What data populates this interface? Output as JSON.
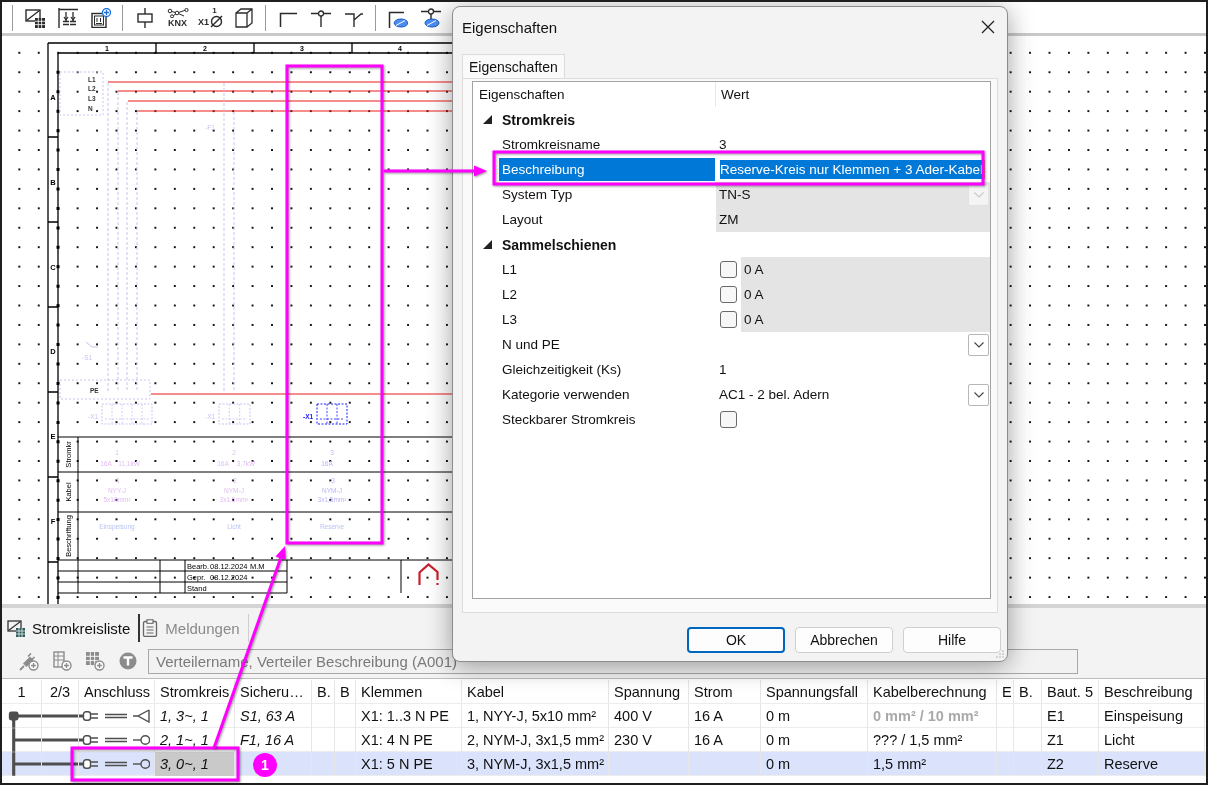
{
  "toolbar": {
    "knx_label": "KNX",
    "terminal_label": "X1",
    "terminal_number": "1"
  },
  "schematic": {
    "column_numbers": [
      "1",
      "2",
      "3",
      "4"
    ],
    "row_letters": [
      "A",
      "B",
      "C",
      "D",
      "E",
      "F"
    ],
    "busbars": [
      "L1",
      "L2",
      "L3",
      "N"
    ],
    "pe_label": "PE",
    "devices": [
      "-F1",
      "-S1"
    ],
    "table_labels": [
      "Stromkr",
      "Kabel",
      "Beschriftung"
    ],
    "circuits": [
      {
        "number": "1",
        "fuse": "16A",
        "power": "11,1kW",
        "cable_name": "-1",
        "cable_type": "NYY-J",
        "cable_size": "5x10mm²",
        "description": "Einspeisung",
        "terminal": "-X1",
        "selected": false
      },
      {
        "number": "2",
        "fuse": "16A",
        "power": "3,7kW",
        "cable_name": "-2",
        "cable_type": "NYM-J",
        "cable_size": "3x1,5mm²",
        "description": "Licht",
        "terminal": "-X1",
        "selected": false
      },
      {
        "number": "3",
        "fuse": "16A",
        "cable_name": "-3",
        "cable_type": "NYM-J",
        "cable_size": "3x1,5mm²",
        "description": "Reserve",
        "terminal": "-X1",
        "selected": true
      }
    ],
    "title_block": [
      {
        "label": "Bearb.",
        "date": "08.12.2024",
        "name": "M.M"
      },
      {
        "label": "Gepr.",
        "date": "08.12.2024"
      },
      {
        "label": "Stand"
      }
    ]
  },
  "panel": {
    "tabs": [
      {
        "label": "Stromkreisliste",
        "selected": true
      },
      {
        "label": "Meldungen",
        "selected": false
      }
    ],
    "distribution_field": {
      "value": "Verteilername, Verteiler Beschreibung (A001)",
      "disabled": true
    },
    "table": {
      "columns": [
        "1",
        "2/3",
        "Anschluss",
        "Stromkreis",
        "Sicheru…",
        "B.",
        "B",
        "Klemmen",
        "Kabel",
        "Spannung",
        "Strom",
        "Spannungsfall",
        "Kabelberechnung",
        "E",
        "B.",
        "Baut. 5",
        "Beschreibung"
      ],
      "rows": [
        {
          "kind": "feed",
          "selected": false,
          "circuit": "1, 3~, 1",
          "circuit_focused": false,
          "fuse": "S1, 63 A",
          "terminals": "X1: 1..3 N PE",
          "cable": "1, NYY-J, 5x10 mm²",
          "voltage": "400 V",
          "current": "16 A",
          "voltage_drop": "0 m",
          "cable_calc": "0 mm² / 10 mm²",
          "cable_calc_greyed": true,
          "component": "E1",
          "description": "Einspeisung"
        },
        {
          "kind": "outlet",
          "selected": false,
          "circuit": "2, 1~, 1",
          "circuit_focused": false,
          "fuse": "F1, 16 A",
          "terminals": "X1: 4 N PE",
          "cable": "2, NYM-J, 3x1,5 mm²",
          "voltage": "230 V",
          "current": "16 A",
          "voltage_drop": "0 m",
          "cable_calc": "??? / 1,5 mm²",
          "cable_calc_greyed": false,
          "component": "Z1",
          "description": "Licht"
        },
        {
          "kind": "outlet",
          "selected": true,
          "circuit": "3, 0~, 1",
          "circuit_focused": true,
          "terminals": "X1: 5 N PE",
          "cable": "3, NYM-J, 3x1,5 mm²",
          "voltage_drop": "0 m",
          "cable_calc": "1,5 mm²",
          "cable_calc_greyed": false,
          "component": "Z2",
          "description": "Reserve"
        }
      ]
    }
  },
  "dialog": {
    "title": "Eigenschaften",
    "tabs": [
      {
        "label": "Eigenschaften",
        "selected": true
      }
    ],
    "columns": [
      "Eigenschaften",
      "Wert"
    ],
    "groups": [
      {
        "label": "Stromkreis",
        "expanded": true,
        "items": [
          {
            "label": "Stromkreisname",
            "kind": "text",
            "value": "3",
            "selected": false,
            "readonly": false
          },
          {
            "label": "Beschreibung",
            "kind": "edit",
            "value": "Reserve-Kreis nur Klemmen + 3 Ader-Kabel",
            "selected": true,
            "readonly": false
          },
          {
            "label": "System Typ",
            "kind": "dropdown",
            "value": "TN-S",
            "selected": false,
            "readonly": true
          },
          {
            "label": "Layout",
            "kind": "text",
            "value": "ZM",
            "selected": false,
            "readonly": true
          }
        ]
      },
      {
        "label": "Sammelschienen",
        "expanded": true,
        "items": [
          {
            "label": "L1",
            "kind": "checkbox",
            "checked": false,
            "value": "0 A",
            "selected": false,
            "readonly": true
          },
          {
            "label": "L2",
            "kind": "checkbox",
            "checked": false,
            "value": "0 A",
            "selected": false,
            "readonly": true
          },
          {
            "label": "L3",
            "kind": "checkbox",
            "checked": false,
            "value": "0 A",
            "selected": false,
            "readonly": true
          },
          {
            "label": "N und PE",
            "kind": "dropdown",
            "selected": false,
            "readonly": false
          },
          {
            "label": "Gleichzeitigkeit (Ks)",
            "kind": "text",
            "value": "1",
            "selected": false,
            "readonly": false
          },
          {
            "label": "Kategorie verwenden",
            "kind": "dropdown",
            "value": "AC1 - 2 bel. Adern",
            "selected": false,
            "readonly": false
          },
          {
            "label": "Steckbarer Stromkreis",
            "kind": "checkbox",
            "checked": false,
            "selected": false,
            "readonly": false
          }
        ]
      }
    ],
    "buttons": [
      {
        "label": "OK",
        "default": true
      },
      {
        "label": "Abbrechen",
        "default": false
      },
      {
        "label": "Hilfe",
        "default": false
      }
    ]
  },
  "annotations": {
    "step_number": "1"
  }
}
